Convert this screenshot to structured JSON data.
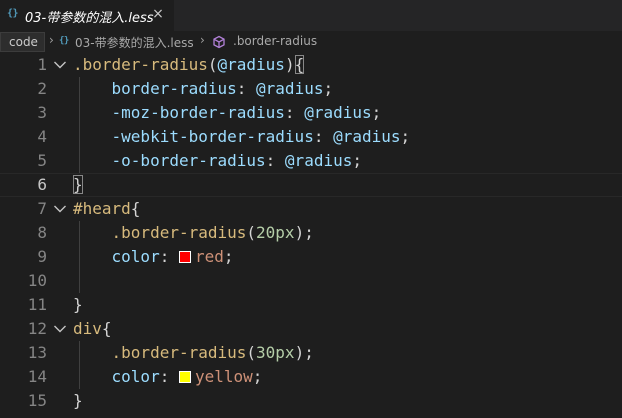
{
  "tab": {
    "icon": "{}",
    "title": "03-带参数的混入.less",
    "close": "×"
  },
  "breadcrumb": {
    "folder": "code",
    "separator": "›",
    "file_icon": "{}",
    "file": "03-带参数的混入.less",
    "symbol": ".border-radius"
  },
  "colors": {
    "background": "#1e1e1e",
    "selector": "#d7ba7d",
    "variable": "#9cdcfe",
    "number": "#b5cea8",
    "value": "#ce9178",
    "swatch_red": "#ff0000",
    "swatch_yellow": "#ffff00"
  },
  "editor": {
    "lines": [
      {
        "n": "1",
        "folded_open": true,
        "tokens": [
          ".border-radius",
          "(",
          "@radius",
          ")",
          "{"
        ]
      },
      {
        "n": "2",
        "tokens": [
          "border-radius",
          ": ",
          "@radius",
          ";"
        ]
      },
      {
        "n": "3",
        "tokens": [
          "-moz-border-radius",
          ": ",
          "@radius",
          ";"
        ]
      },
      {
        "n": "4",
        "tokens": [
          "-webkit-border-radius",
          ": ",
          "@radius",
          ";"
        ]
      },
      {
        "n": "5",
        "tokens": [
          "-o-border-radius",
          ": ",
          "@radius",
          ";"
        ]
      },
      {
        "n": "6",
        "tokens": [
          "}"
        ]
      },
      {
        "n": "7",
        "folded_open": true,
        "tokens": [
          "#heard",
          "{"
        ]
      },
      {
        "n": "8",
        "tokens": [
          ".border-radius",
          "(",
          "20px",
          ");"
        ]
      },
      {
        "n": "9",
        "tokens": [
          "color",
          ": ",
          "red",
          ";"
        ]
      },
      {
        "n": "10",
        "tokens": []
      },
      {
        "n": "11",
        "tokens": [
          "}"
        ]
      },
      {
        "n": "12",
        "folded_open": true,
        "tokens": [
          "div",
          "{"
        ]
      },
      {
        "n": "13",
        "tokens": [
          ".border-radius",
          "(",
          "30px",
          ");"
        ]
      },
      {
        "n": "14",
        "tokens": [
          "color",
          ": ",
          "yellow",
          ";"
        ]
      },
      {
        "n": "15",
        "tokens": [
          "}"
        ]
      }
    ]
  }
}
